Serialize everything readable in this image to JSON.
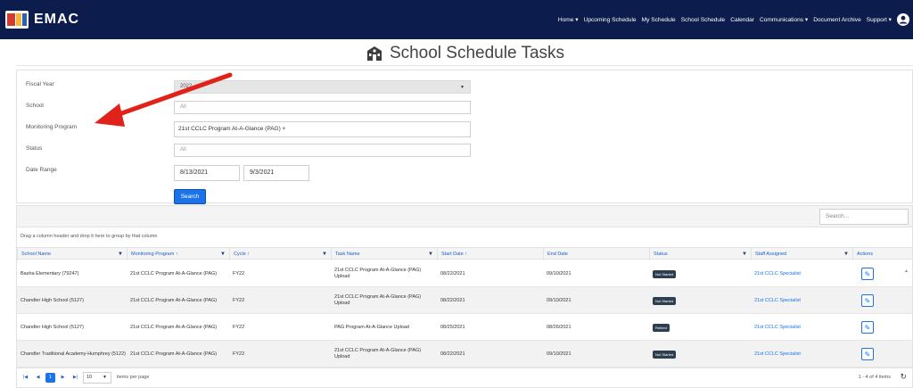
{
  "brand": {
    "name": "EMAC"
  },
  "nav": {
    "items": [
      "Home ▾",
      "Upcoming Schedule",
      "My Schedule",
      "School Schedule",
      "Calendar",
      "Communications ▾",
      "Document Archive",
      "Support ▾"
    ]
  },
  "page": {
    "title": "School Schedule Tasks"
  },
  "filters": {
    "fiscal_year": {
      "label": "Fiscal Year",
      "value": "2022"
    },
    "school": {
      "label": "School",
      "placeholder": "All"
    },
    "monitoring_program": {
      "label": "Monitoring Program",
      "selected": "21st CCLC Program At-A-Glance (PAG) ×"
    },
    "status": {
      "label": "Status",
      "placeholder": "All"
    },
    "date_range": {
      "label": "Date Range",
      "start": "8/13/2021",
      "end": "9/3/2021"
    },
    "search_button": "Search"
  },
  "grid": {
    "search_placeholder": "Search...",
    "group_hint": "Drag a column header and drop it here to group by that column",
    "columns": [
      "School Name",
      "Monitoring Program ↑",
      "Cycle ↑",
      "Task Name",
      "Start Date ↑",
      "End Date",
      "Status",
      "Staff Assigned",
      "Actions"
    ],
    "rows": [
      {
        "school": "Basha Elementary (79247)",
        "program": "21st CCLC Program At-A-Glance (PAG)",
        "cycle": "FY22",
        "task": "21st CCLC Program At-A-Glance (PAG) Upload",
        "start": "08/22/2021",
        "end": "09/10/2021",
        "status": "Not Started",
        "staff": "21st CCLC Specialist"
      },
      {
        "school": "Chandler High School (5127)",
        "program": "21st CCLC Program At-A-Glance (PAG)",
        "cycle": "FY22",
        "task": "21st CCLC Program At-A-Glance (PAG) Upload",
        "start": "08/22/2021",
        "end": "09/10/2021",
        "status": "Not Started",
        "staff": "21st CCLC Specialist"
      },
      {
        "school": "Chandler High School (5127)",
        "program": "21st CCLC Program At-A-Glance (PAG)",
        "cycle": "FY22",
        "task": "PAG Program At-A-Glance Upload",
        "start": "08/25/2021",
        "end": "08/26/2021",
        "status": "Retired",
        "staff": "21st CCLC Specialist"
      },
      {
        "school": "Chandler Traditional Academy-Humphrey (5122)",
        "program": "21st CCLC Program At-A-Glance (PAG)",
        "cycle": "FY22",
        "task": "21st CCLC Program At-A-Glance (PAG) Upload",
        "start": "08/22/2021",
        "end": "09/10/2021",
        "status": "Not Started",
        "staff": "21st CCLC Specialist"
      }
    ],
    "pager": {
      "page": "1",
      "page_size": "10",
      "items_per_page": "items per page",
      "info": "1 - 4 of 4 items"
    }
  },
  "colors": {
    "nav": "#0b1c4d",
    "accent": "#1a73e8",
    "arrow": "#e0221b"
  }
}
